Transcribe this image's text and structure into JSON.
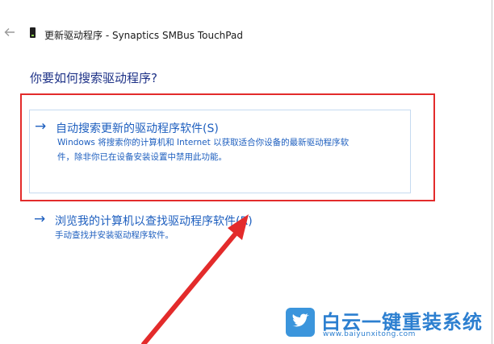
{
  "window": {
    "title": "更新驱动程序 - Synaptics SMBus TouchPad"
  },
  "question": "你要如何搜索驱动程序?",
  "options": [
    {
      "title": "自动搜索更新的驱动程序软件(S)",
      "desc_line1": "Windows 将搜索你的计算机和 Internet 以获取适合你设备的最新驱动程序软",
      "desc_line2": "件，除非你已在设备安装设置中禁用此功能。"
    },
    {
      "title": "浏览我的计算机以查找驱动程序软件(R)",
      "desc_line1": "手动查找并安装驱动程序软件。"
    }
  ],
  "watermark": {
    "brand": "白云一键重装系统",
    "url": "www.baiyunxitong.com"
  },
  "colors": {
    "link_blue": "#1e5fbf",
    "heading_blue": "#1e3287",
    "highlight_red": "#e32b2b",
    "brand_blue": "#2c7fd0"
  },
  "icons": {
    "back": "back-arrow-icon",
    "device": "touchpad-device-icon",
    "option_arrow": "right-arrow-icon",
    "logo": "twitter-bird-logo-icon"
  }
}
